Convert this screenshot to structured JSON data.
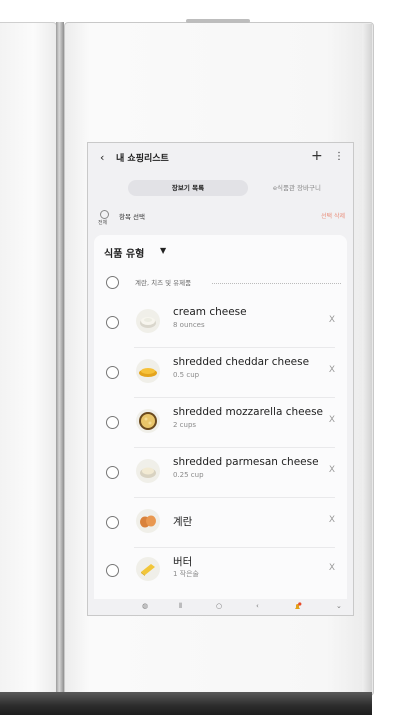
{
  "header": {
    "title": "내 쇼핑리스트",
    "back_icon": "chevron-left-icon",
    "add_icon": "plus-icon",
    "more_icon": "more-vertical-icon"
  },
  "tabs": [
    {
      "label": "장보기 목록",
      "active": true
    },
    {
      "label": "e식품관 장바구니",
      "active": false
    }
  ],
  "selection": {
    "all_label": "전체",
    "select_label": "항목 선택",
    "delete_label": "선택 삭제"
  },
  "section": {
    "title": "식품 유형",
    "caret": "▼"
  },
  "group": {
    "label": "계란, 치즈 및 유제품"
  },
  "items": [
    {
      "name": "cream cheese",
      "qty": "8 ounces",
      "icon": "cream-cheese-icon",
      "remove": "X"
    },
    {
      "name": "shredded cheddar cheese",
      "qty": "0.5 cup",
      "icon": "cheddar-icon",
      "remove": "X"
    },
    {
      "name": "shredded mozzarella cheese",
      "qty": "2 cups",
      "icon": "mozzarella-icon",
      "remove": "X"
    },
    {
      "name": "shredded parmesan cheese",
      "qty": "0.25 cup",
      "icon": "parmesan-icon",
      "remove": "X"
    },
    {
      "name": "계란",
      "qty": "",
      "icon": "eggs-icon",
      "remove": "X"
    },
    {
      "name": "버터",
      "qty": "1 작은술",
      "icon": "butter-icon",
      "remove": "X"
    }
  ],
  "navbar": {
    "icons": [
      "bixby-icon",
      "recents-icon",
      "home-icon",
      "back-icon",
      "notification-icon",
      "expand-icon"
    ]
  },
  "colors": {
    "delete_accent": "#e98e7a",
    "screen_bg": "#f1f1f3",
    "card_bg": "#fbfbfc"
  }
}
